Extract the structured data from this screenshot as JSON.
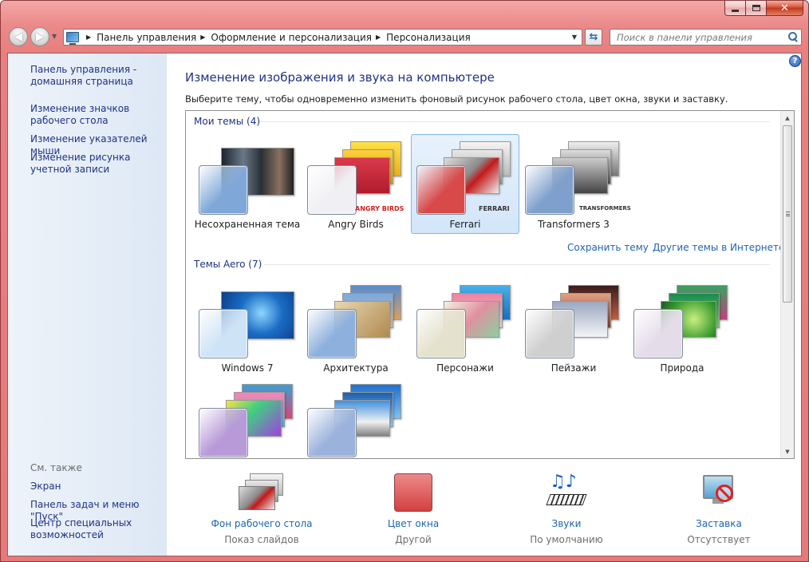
{
  "addressbar": {
    "crumbs": [
      "Панель управления",
      "Оформление и персонализация",
      "Персонализация"
    ]
  },
  "search": {
    "placeholder": "Поиск в панели управления"
  },
  "sidebar": {
    "links": [
      {
        "label": "Панель управления - домашняя страница"
      },
      {
        "label": "Изменение значков рабочего стола"
      },
      {
        "label": "Изменение указателей мыши"
      },
      {
        "label": "Изменение рисунка учетной записи"
      }
    ],
    "see_also_title": "См. также",
    "see_also": [
      {
        "label": "Экран"
      },
      {
        "label": "Панель задач и меню \"Пуск\""
      },
      {
        "label": "Центр специальных возможностей"
      }
    ]
  },
  "main": {
    "title": "Изменение изображения и звука на компьютере",
    "description": "Выберите тему, чтобы одновременно изменить фоновый рисунок рабочего стола, цвет окна, звуки и заставку."
  },
  "themes": {
    "my_header": "Мои темы (4)",
    "my": [
      {
        "label": "Несохраненная тема",
        "swatch": "#7fa8d8"
      },
      {
        "label": "Angry Birds",
        "swatch": "#f0f0f4",
        "brand": "ANGRY BIRDS"
      },
      {
        "label": "Ferrari",
        "swatch": "#d84a4a",
        "brand": "FERRARI"
      },
      {
        "label": "Transformers 3",
        "swatch": "#7fa0cc",
        "brand": "TRANSFORMERS"
      }
    ],
    "save_theme": "Сохранить тему",
    "online_themes": "Другие темы в Интернете",
    "aero_header": "Темы Aero (7)",
    "aero": [
      {
        "label": "Windows 7",
        "swatch": "#cfe3f7"
      },
      {
        "label": "Архитектура",
        "swatch": "#8eb0dc"
      },
      {
        "label": "Персонажи",
        "swatch": "#e4e1cc"
      },
      {
        "label": "Пейзажи",
        "swatch": "#cfcfcf"
      },
      {
        "label": "Природа",
        "swatch": "#e5dcea"
      },
      {
        "label": "",
        "swatch": "#b79ad7"
      },
      {
        "label": "",
        "swatch": "#9ab2dc"
      }
    ]
  },
  "bottom": [
    {
      "title": "Фон рабочего стола",
      "subtitle": "Показ слайдов"
    },
    {
      "title": "Цвет окна",
      "subtitle": "Другой",
      "color": "#de5a5a"
    },
    {
      "title": "Звуки",
      "subtitle": "По умолчанию"
    },
    {
      "title": "Заставка",
      "subtitle": "Отсутствует"
    }
  ]
}
